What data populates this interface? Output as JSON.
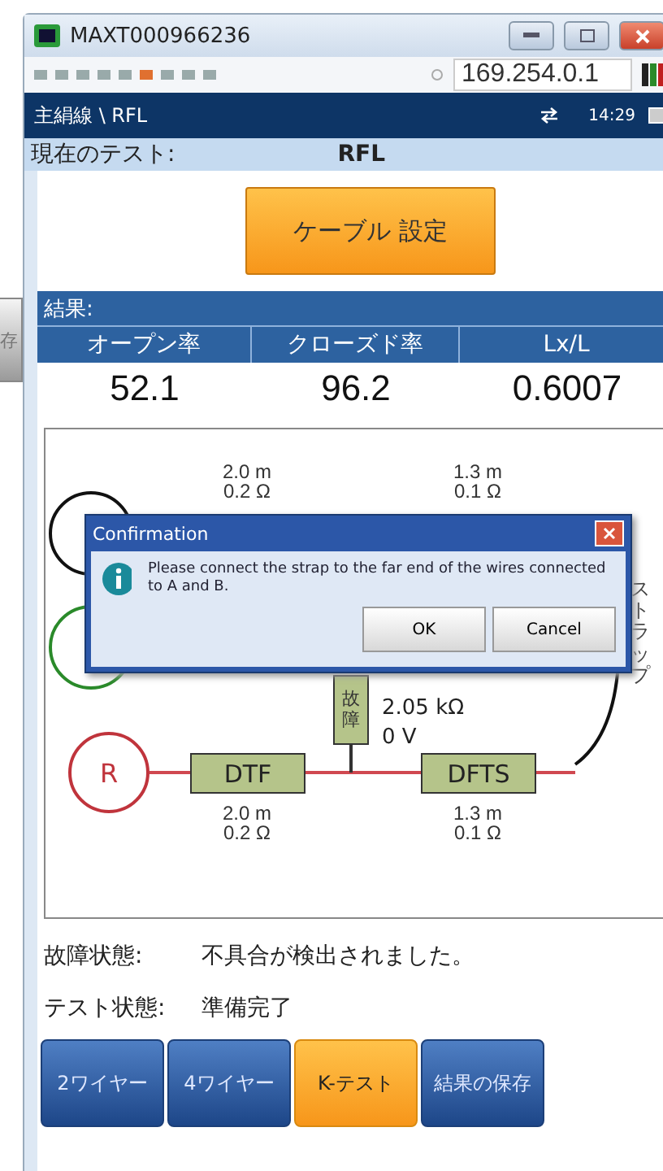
{
  "window": {
    "title": "MAXT000966236",
    "address": "169.254.0.1"
  },
  "side_button": {
    "label": "存"
  },
  "header": {
    "path": "主絹線 \\ RFL",
    "time": "14:29"
  },
  "current_test": {
    "label": "現在のテスト:",
    "value": "RFL"
  },
  "cable_button": {
    "label": "ケーブル 設定"
  },
  "results": {
    "title": "結果:",
    "columns": [
      "オープン率",
      "クローズド率",
      "Lx/L"
    ],
    "values": [
      "52.1",
      "96.2",
      "0.6007"
    ]
  },
  "diagram": {
    "start": "R",
    "segments": [
      {
        "name": "DTF",
        "top_length": "2.0 m",
        "top_resistance": "0.2 Ω",
        "bottom_length": "2.0 m",
        "bottom_resistance": "0.2 Ω"
      },
      {
        "name": "DFTS",
        "top_length": "1.3 m",
        "top_resistance": "0.1 Ω",
        "bottom_length": "1.3 m",
        "bottom_resistance": "0.1 Ω"
      }
    ],
    "fault": {
      "label": "故障",
      "resistance": "2.05 kΩ",
      "voltage": "0 V"
    },
    "strap": "ストラップ"
  },
  "dialog": {
    "title": "Confirmation",
    "message": "Please connect the strap to the far end of the wires connected to A and B.",
    "buttons": [
      "OK",
      "Cancel"
    ]
  },
  "status": [
    {
      "label": "故障状態:",
      "value": "不具合が検出されました。"
    },
    {
      "label": "テスト状態:",
      "value": "準備完了"
    }
  ],
  "tabs": [
    {
      "label": "2ワイヤー",
      "selected": false
    },
    {
      "label": "4ワイヤー",
      "selected": false
    },
    {
      "label": "K-テスト",
      "selected": true
    },
    {
      "label": "結果の保存",
      "selected": false
    }
  ]
}
